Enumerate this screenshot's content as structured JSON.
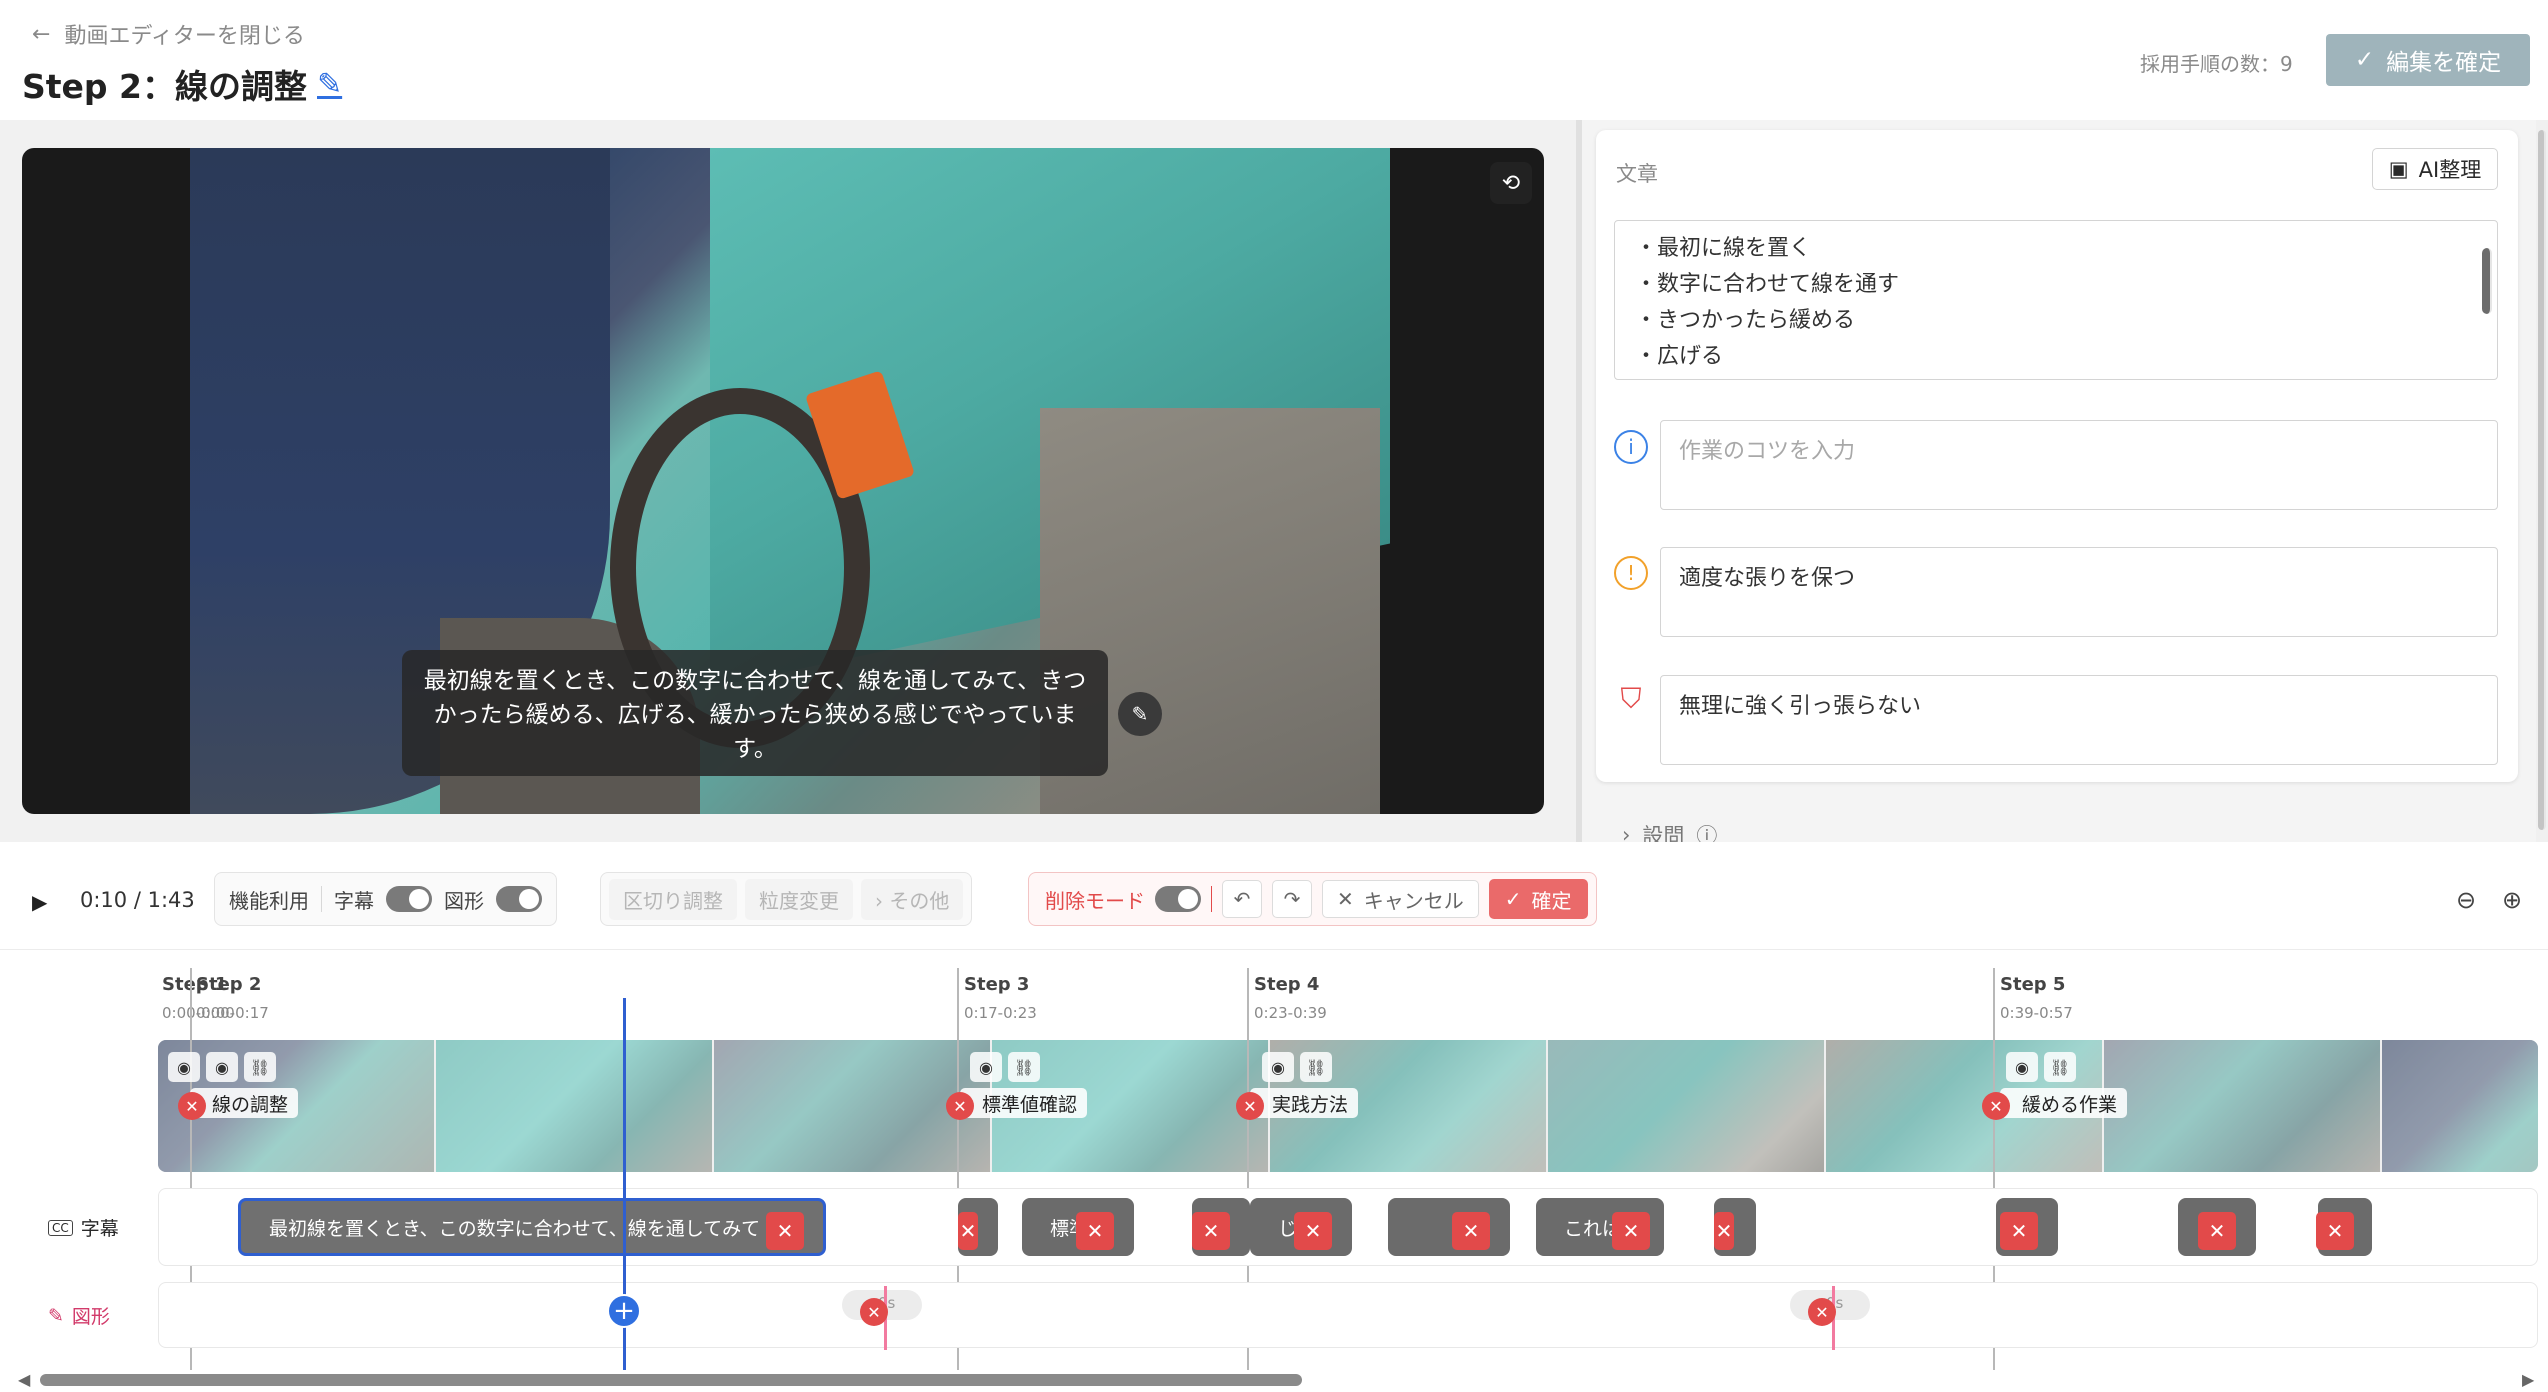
{
  "header": {
    "back_label": "動画エディターを閉じる",
    "title": "Step 2：線の調整",
    "adopt_count": "採用手順の数：9",
    "confirm_label": "編集を確定"
  },
  "video": {
    "caption": "最初線を置くとき、この数字に合わせて、線を通してみて、きつかったら緩める、広げる、緩かったら狭める感じでやっています。"
  },
  "panel": {
    "text_label": "文章",
    "ai_button": "AI整理",
    "text_lines": [
      "・最初に線を置く",
      "・数字に合わせて線を通す",
      "・きつかったら緩める",
      "・広げる"
    ],
    "tip_placeholder": "作業のコツを入力",
    "caution_value": "適度な張りを保つ",
    "safety_value": "無理に強く引っ張らない",
    "questions_label": "設問"
  },
  "toolbar": {
    "time": "0:10 / 1:43",
    "feature_label": "機能利用",
    "subtitle_label": "字幕",
    "shape_label": "図形",
    "split_adjust": "区切り調整",
    "granularity": "粒度変更",
    "other": "その他",
    "delete_mode": "削除モード",
    "cancel": "キャンセル",
    "ok": "確定"
  },
  "timeline": {
    "steps": [
      {
        "label": "Step 1",
        "time": "0:00-0:00"
      },
      {
        "label": "Step 2",
        "time": "0:00-0:17"
      },
      {
        "label": "Step 3",
        "time": "0:17-0:23"
      },
      {
        "label": "Step 4",
        "time": "0:23-0:39"
      },
      {
        "label": "Step 5",
        "time": "0:39-0:57"
      }
    ],
    "segment_names": [
      "線の調整",
      "標準値確認",
      "実践方法",
      "緩める作業"
    ],
    "row_subtitle": "字幕",
    "row_shape": "図形",
    "subtitle_clips": [
      "最初線を置くとき、この数字に合わせて、線を通してみて",
      "標準",
      "じ",
      "これは"
    ],
    "shape_pill": "0s"
  },
  "colors": {
    "accent_blue": "#2f6fe0",
    "delete_red": "#e24a4a",
    "confirm_disabled": "#9fb4bb"
  }
}
